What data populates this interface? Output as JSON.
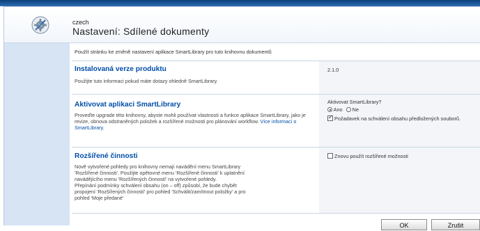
{
  "header": {
    "site_name": "czech",
    "page_title": "Nastavení: Sdílené dokumenty"
  },
  "intro": "Použít stránku ke změně nastavení aplikace SmartLibrary pro tuto knihovnu dokumentů",
  "sections": {
    "version": {
      "title": "Instalovaná verze produktu",
      "description": "Použijte tuto informaci pokud máte dotazy ohledně SmartLibrary.",
      "value": "2.1.0"
    },
    "activate": {
      "title": "Aktivovat aplikaci SmartLibrary",
      "description": "Proveďte upgrade této knihovny, abyste mohli používat vlastnosti a funkce aplikace SmartLibrary, jako je revize, obnova odstraněných položek a rozšířené možnosti pro plánování workflow.",
      "link_text": "Více informací o SmartLibrary.",
      "question": "Aktivovat SmartLibrary?",
      "option_yes": "Ano",
      "option_no": "Ne",
      "selected": "Ano",
      "approval_checked": true,
      "approval_label": "Požadavek na schválení obsahu předložených souborů."
    },
    "extended": {
      "title": "Rozšířené činnosti",
      "description_lines": [
        "Nově vytvořené pohledy pro knihovny nemají navádění menu SmartLibrary",
        "'Rozšířené činnosti'. Použijte opětovné menu 'Rozšířené činnosti' k uplatnění",
        "navádějícího menu 'Rozšířených činností' na vytvořené pohledy.",
        "Přepínání podmínky schválení obsahu (on – off) způsobí, že bude chybět",
        "propojení 'Rozšířených činností' pro pohled 'Schválit/zamítnout položky' a pro",
        "pohled 'Moje předané'"
      ],
      "reuse_checked": false,
      "reuse_label": "Znovu použít rozšířené možnosti"
    }
  },
  "buttons": {
    "ok": "OK",
    "cancel": "Zrušit"
  },
  "icons": {
    "logo": "settings-gear-icon"
  }
}
